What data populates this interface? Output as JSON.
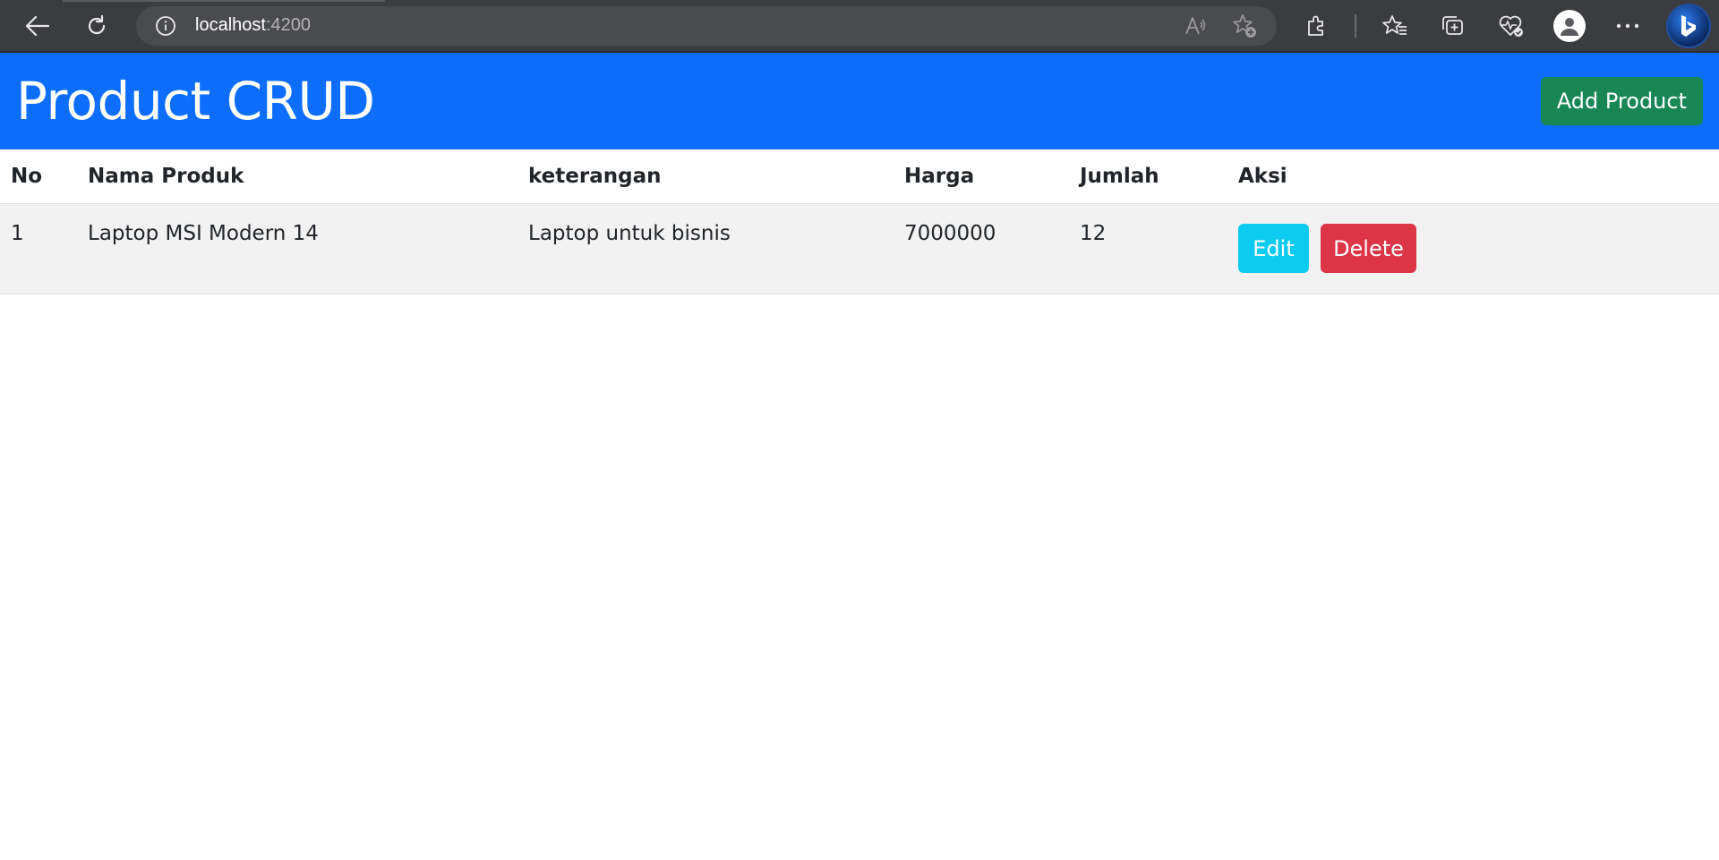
{
  "browser": {
    "url_host": "localhost",
    "url_port": ":4200",
    "icons": {
      "back": "back-arrow-icon",
      "reload": "reload-icon",
      "site_info": "info-icon",
      "read_aloud": "read-aloud-icon",
      "add_favorite": "add-favorite-icon",
      "extensions": "extensions-icon",
      "favorites": "favorites-icon",
      "collections": "collections-icon",
      "performance": "heart-pulse-icon",
      "profile": "profile-icon",
      "more": "more-dots-icon",
      "copilot": "bing-icon"
    }
  },
  "header": {
    "title": "Product CRUD",
    "add_button_label": "Add Product"
  },
  "table": {
    "columns": [
      "No",
      "Nama Produk",
      "keterangan",
      "Harga",
      "Jumlah",
      "Aksi"
    ],
    "rows": [
      {
        "no": "1",
        "nama_produk": "Laptop MSI Modern 14",
        "keterangan": "Laptop untuk bisnis",
        "harga": "7000000",
        "jumlah": "12",
        "edit_label": "Edit",
        "delete_label": "Delete"
      }
    ]
  },
  "colors": {
    "navbar": "#0d6efd",
    "add_button": "#198754",
    "edit_button": "#0dcaf0",
    "delete_button": "#dc3545"
  }
}
